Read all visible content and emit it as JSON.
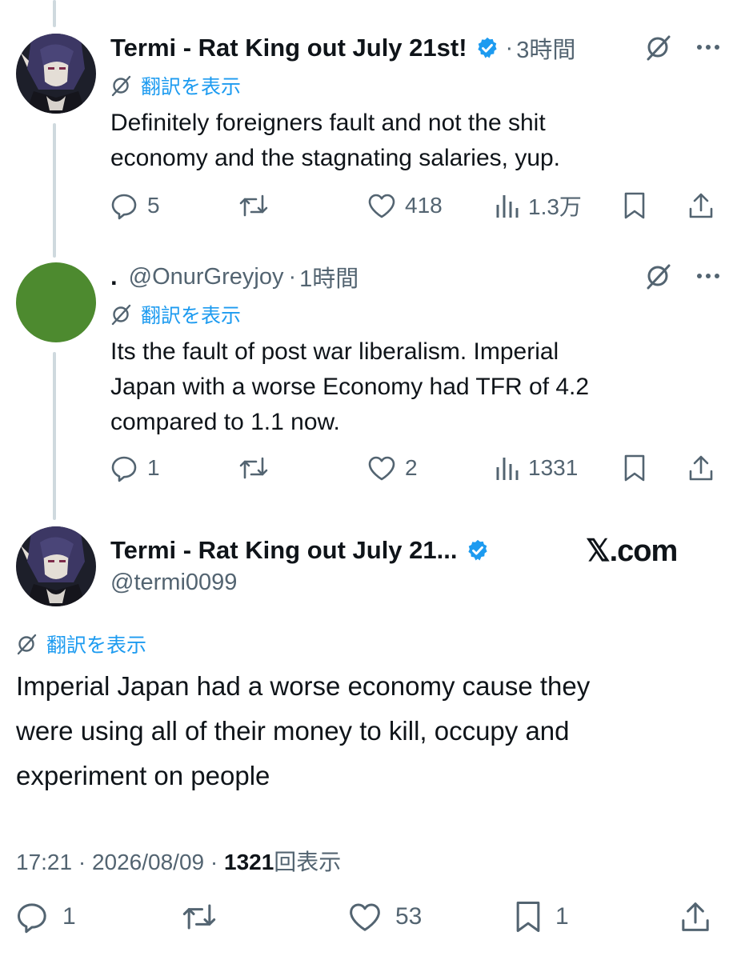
{
  "post1": {
    "display_name": "Termi - Rat King out July 21st!",
    "time": "3時間",
    "translate_label": "翻訳を表示",
    "text_line1": "Definitely foreigners fault and not the shit",
    "text_line2": "economy and the stagnating salaries, yup.",
    "replies": "5",
    "reposts": "",
    "likes": "418",
    "views": "1.3万"
  },
  "post2": {
    "display_name": ".",
    "handle": "@OnurGreyjoy",
    "time": "1時間",
    "translate_label": "翻訳を表示",
    "text_line1": "Its the fault of post war liberalism. Imperial",
    "text_line2": "Japan with a worse Economy had TFR of 4.2",
    "text_line3": "compared to 1.1 now.",
    "replies": "1",
    "reposts": "",
    "likes": "2",
    "views": "1331"
  },
  "main": {
    "display_name": "Termi - Rat King out July 21...",
    "handle": "@termi0099",
    "watermark": "𝕏.com",
    "translate_label": "翻訳を表示",
    "text_line1": "Imperial Japan had a worse economy cause they",
    "text_line2": "were using all of their money to kill, occupy and",
    "text_line3": "experiment on people",
    "time": "17:21",
    "date": "2026/08/09",
    "views_count": "1321",
    "views_label": "回表示",
    "replies": "1",
    "reposts": "",
    "likes": "53",
    "bookmarks": "1"
  },
  "colors": {
    "accent": "#1d9bf0",
    "muted": "#536471",
    "text": "#0f1419",
    "avatar_green": "#4d8a2f"
  },
  "icons": [
    "reply-icon",
    "repost-icon",
    "like-icon",
    "views-icon",
    "bookmark-icon",
    "share-icon",
    "grok-icon",
    "more-icon",
    "verified-badge-icon",
    "translate-icon"
  ]
}
